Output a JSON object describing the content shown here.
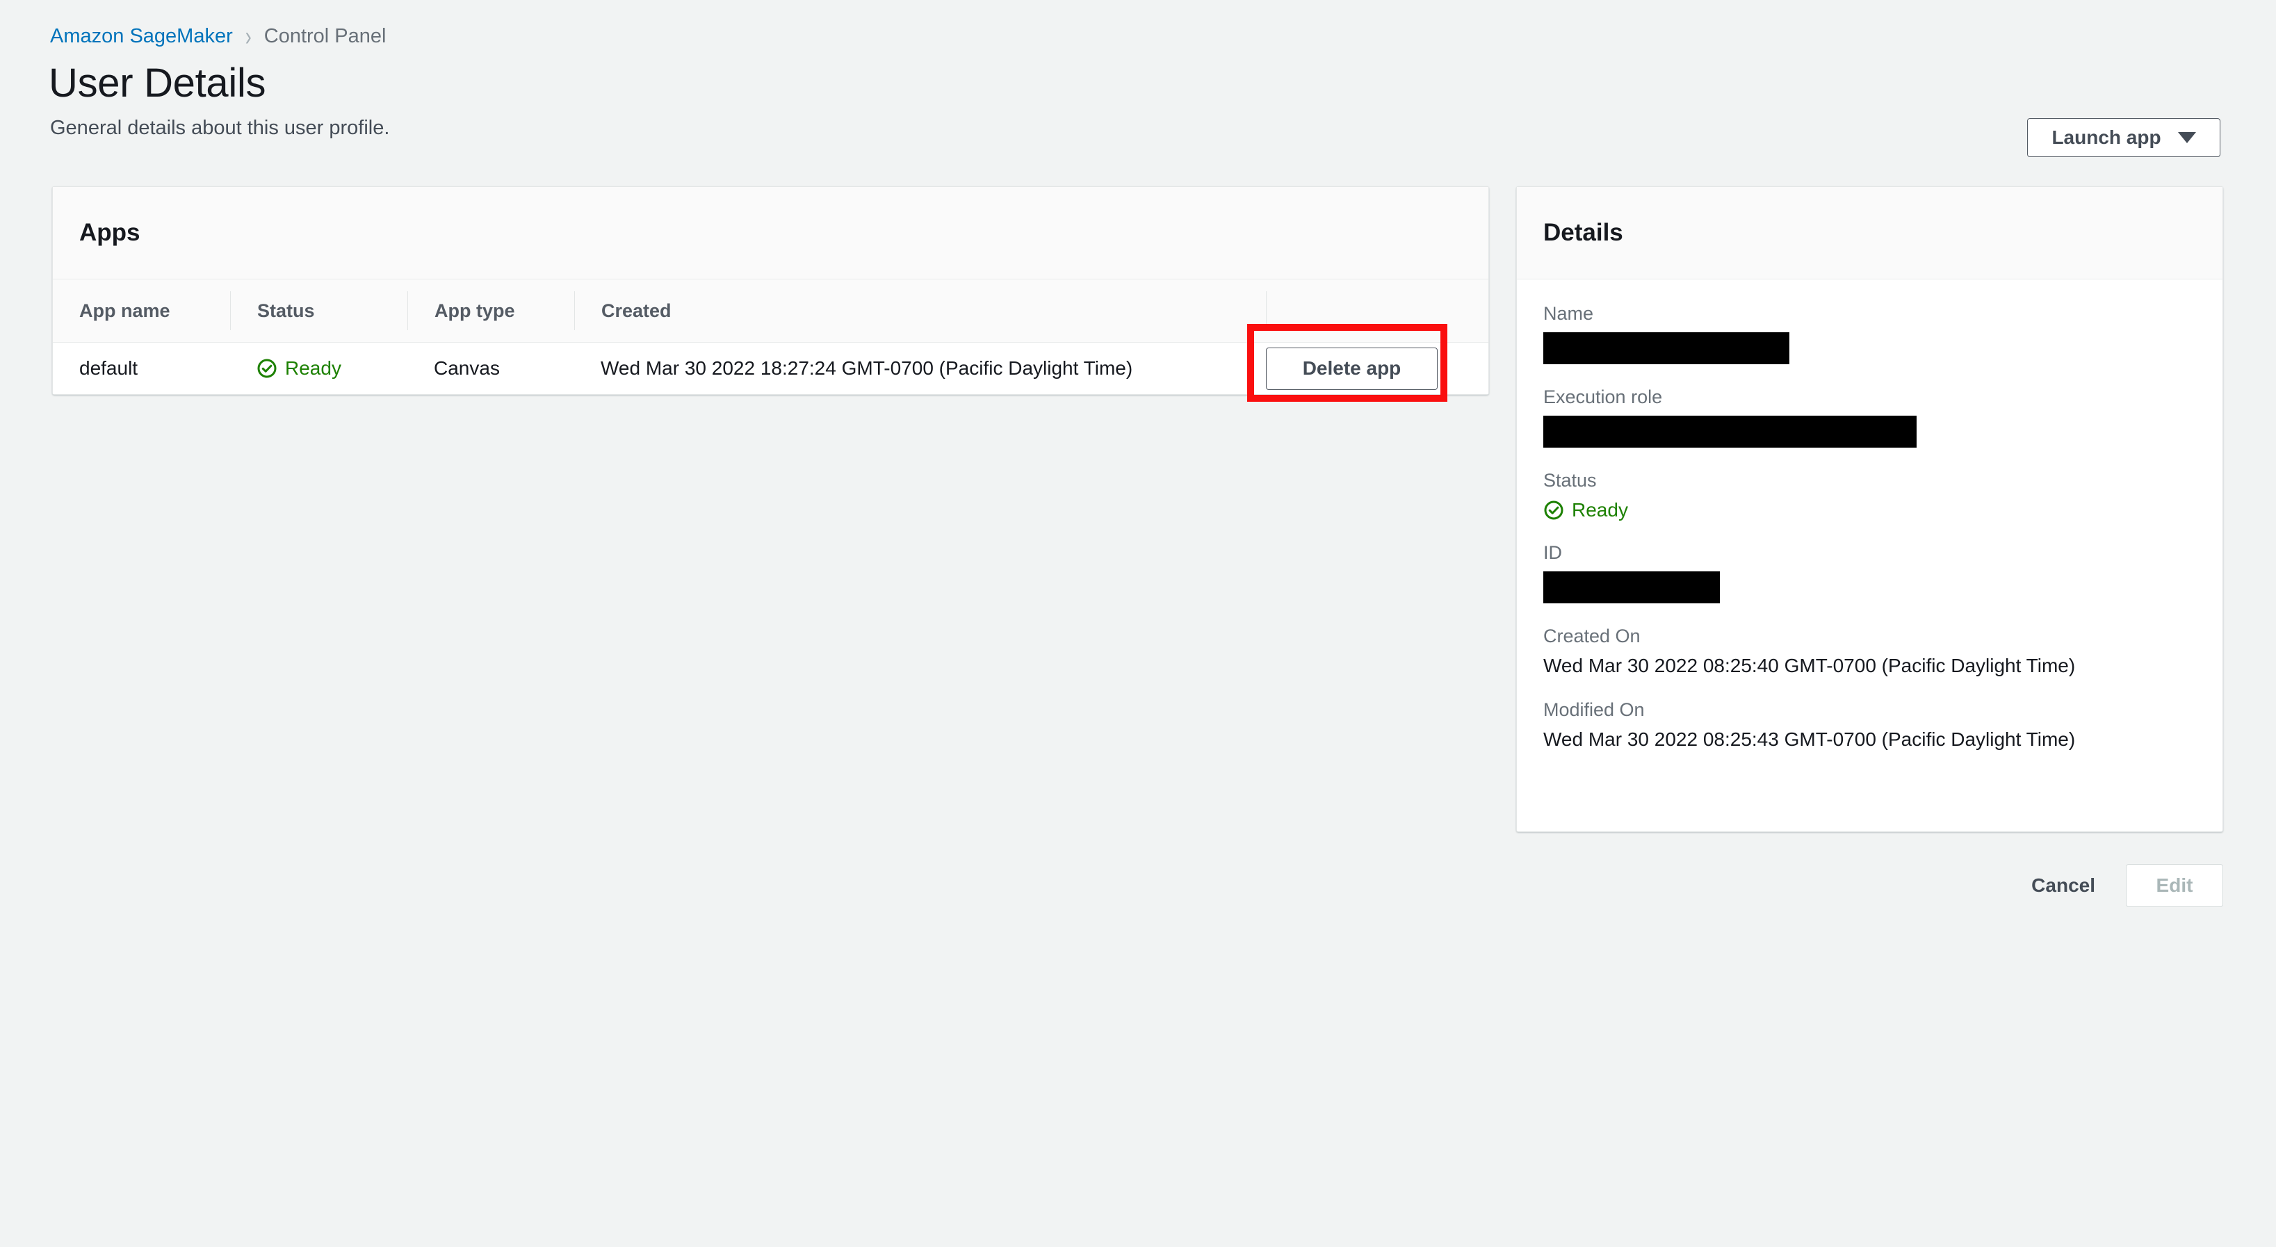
{
  "breadcrumb": {
    "root_label": "Amazon SageMaker",
    "separator": "›",
    "current_label": "Control Panel"
  },
  "header": {
    "title": "User Details",
    "subtitle": "General details about this user profile.",
    "launch_app_label": "Launch app",
    "launch_app_icon": "chevron-down-icon"
  },
  "apps_card": {
    "title": "Apps",
    "columns": [
      {
        "key": "app_name",
        "label": "App name"
      },
      {
        "key": "status",
        "label": "Status"
      },
      {
        "key": "app_type",
        "label": "App type"
      },
      {
        "key": "created",
        "label": "Created"
      },
      {
        "key": "action",
        "label": ""
      }
    ],
    "rows": [
      {
        "app_name": "default",
        "status": "Ready",
        "status_icon": "check-circle-icon",
        "status_color": "#1d8102",
        "app_type": "Canvas",
        "created": "Wed Mar 30 2022 18:27:24 GMT-0700 (Pacific Daylight Time)",
        "action_label": "Delete app"
      }
    ]
  },
  "annotation": {
    "highlight_color": "#fa0f0f",
    "highlight_target": "Delete app"
  },
  "details_card": {
    "title": "Details",
    "fields": [
      {
        "label": "Name",
        "type": "redacted",
        "redact_width": 354
      },
      {
        "label": "Execution role",
        "type": "redacted",
        "redact_width": 537
      },
      {
        "label": "Status",
        "type": "status",
        "value": "Ready",
        "icon": "check-circle-icon",
        "color": "#1d8102"
      },
      {
        "label": "ID",
        "type": "redacted",
        "redact_width": 254
      },
      {
        "label": "Created On",
        "type": "text",
        "value": "Wed Mar 30 2022 08:25:40 GMT-0700 (Pacific Daylight Time)"
      },
      {
        "label": "Modified On",
        "type": "text",
        "value": "Wed Mar 30 2022 08:25:43 GMT-0700 (Pacific Daylight Time)"
      }
    ]
  },
  "footer": {
    "cancel_label": "Cancel",
    "edit_label": "Edit",
    "edit_disabled": true
  },
  "colors": {
    "page_background": "#f1f3f3",
    "card_background": "#ffffff",
    "card_header_background": "#fafafa",
    "link": "#0073bb",
    "text_primary": "#16191f",
    "text_secondary": "#687078",
    "success": "#1d8102",
    "annotation_red": "#fa0f0f"
  }
}
